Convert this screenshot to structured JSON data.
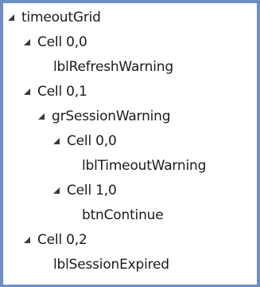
{
  "tree": {
    "nodes": [
      {
        "label": "timeoutGrid",
        "expanded": true,
        "icon": "expanded-triangle-icon"
      },
      {
        "label": "Cell 0,0",
        "expanded": true,
        "icon": "expanded-triangle-icon"
      },
      {
        "label": "lblRefreshWarning",
        "expanded": null
      },
      {
        "label": "Cell 0,1",
        "expanded": true,
        "icon": "expanded-triangle-icon"
      },
      {
        "label": "grSessionWarning",
        "expanded": true,
        "icon": "expanded-triangle-icon"
      },
      {
        "label": "Cell 0,0",
        "expanded": true,
        "icon": "expanded-triangle-icon"
      },
      {
        "label": "lblTimeoutWarning",
        "expanded": null
      },
      {
        "label": "Cell 1,0",
        "expanded": true,
        "icon": "expanded-triangle-icon"
      },
      {
        "label": "btnContinue",
        "expanded": null
      },
      {
        "label": "Cell 0,2",
        "expanded": true,
        "icon": "expanded-triangle-icon"
      },
      {
        "label": "lblSessionExpired",
        "expanded": null
      }
    ]
  },
  "colors": {
    "frame_border": "#6f8fc4",
    "text": "#1b1b1b",
    "expander": "#3a3a3a",
    "background": "#ffffff"
  }
}
